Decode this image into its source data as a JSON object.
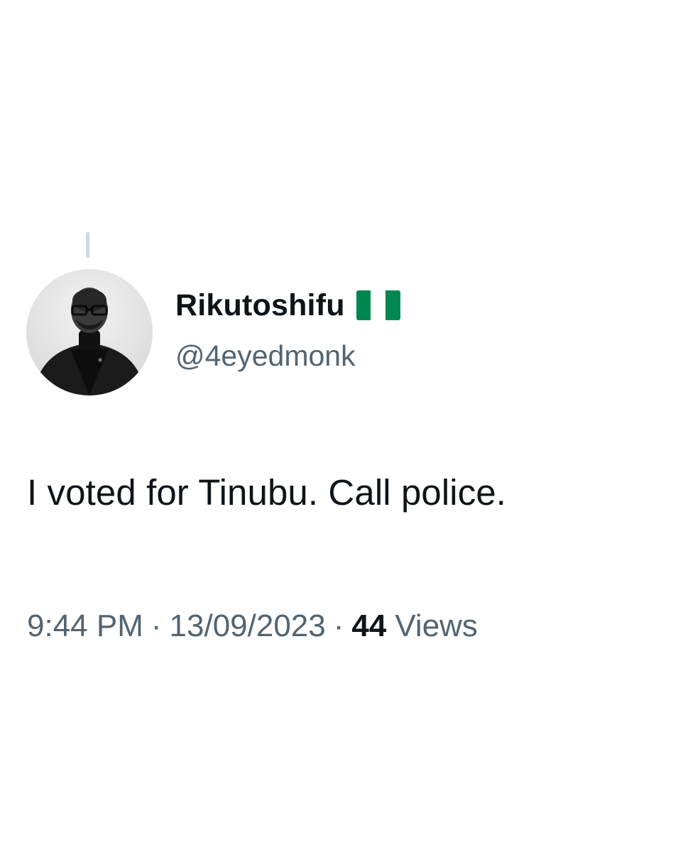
{
  "tweet": {
    "display_name": "Rikutoshifu",
    "flag_icon": "nigeria-flag-icon",
    "flag_colors": [
      "#008751",
      "#ffffff",
      "#008751"
    ],
    "handle": "@4eyedmonk",
    "text": "I voted for Tinubu. Call police.",
    "time": "9:44 PM",
    "separator": "·",
    "date": "13/09/2023",
    "views_count": "44",
    "views_label": "Views"
  }
}
